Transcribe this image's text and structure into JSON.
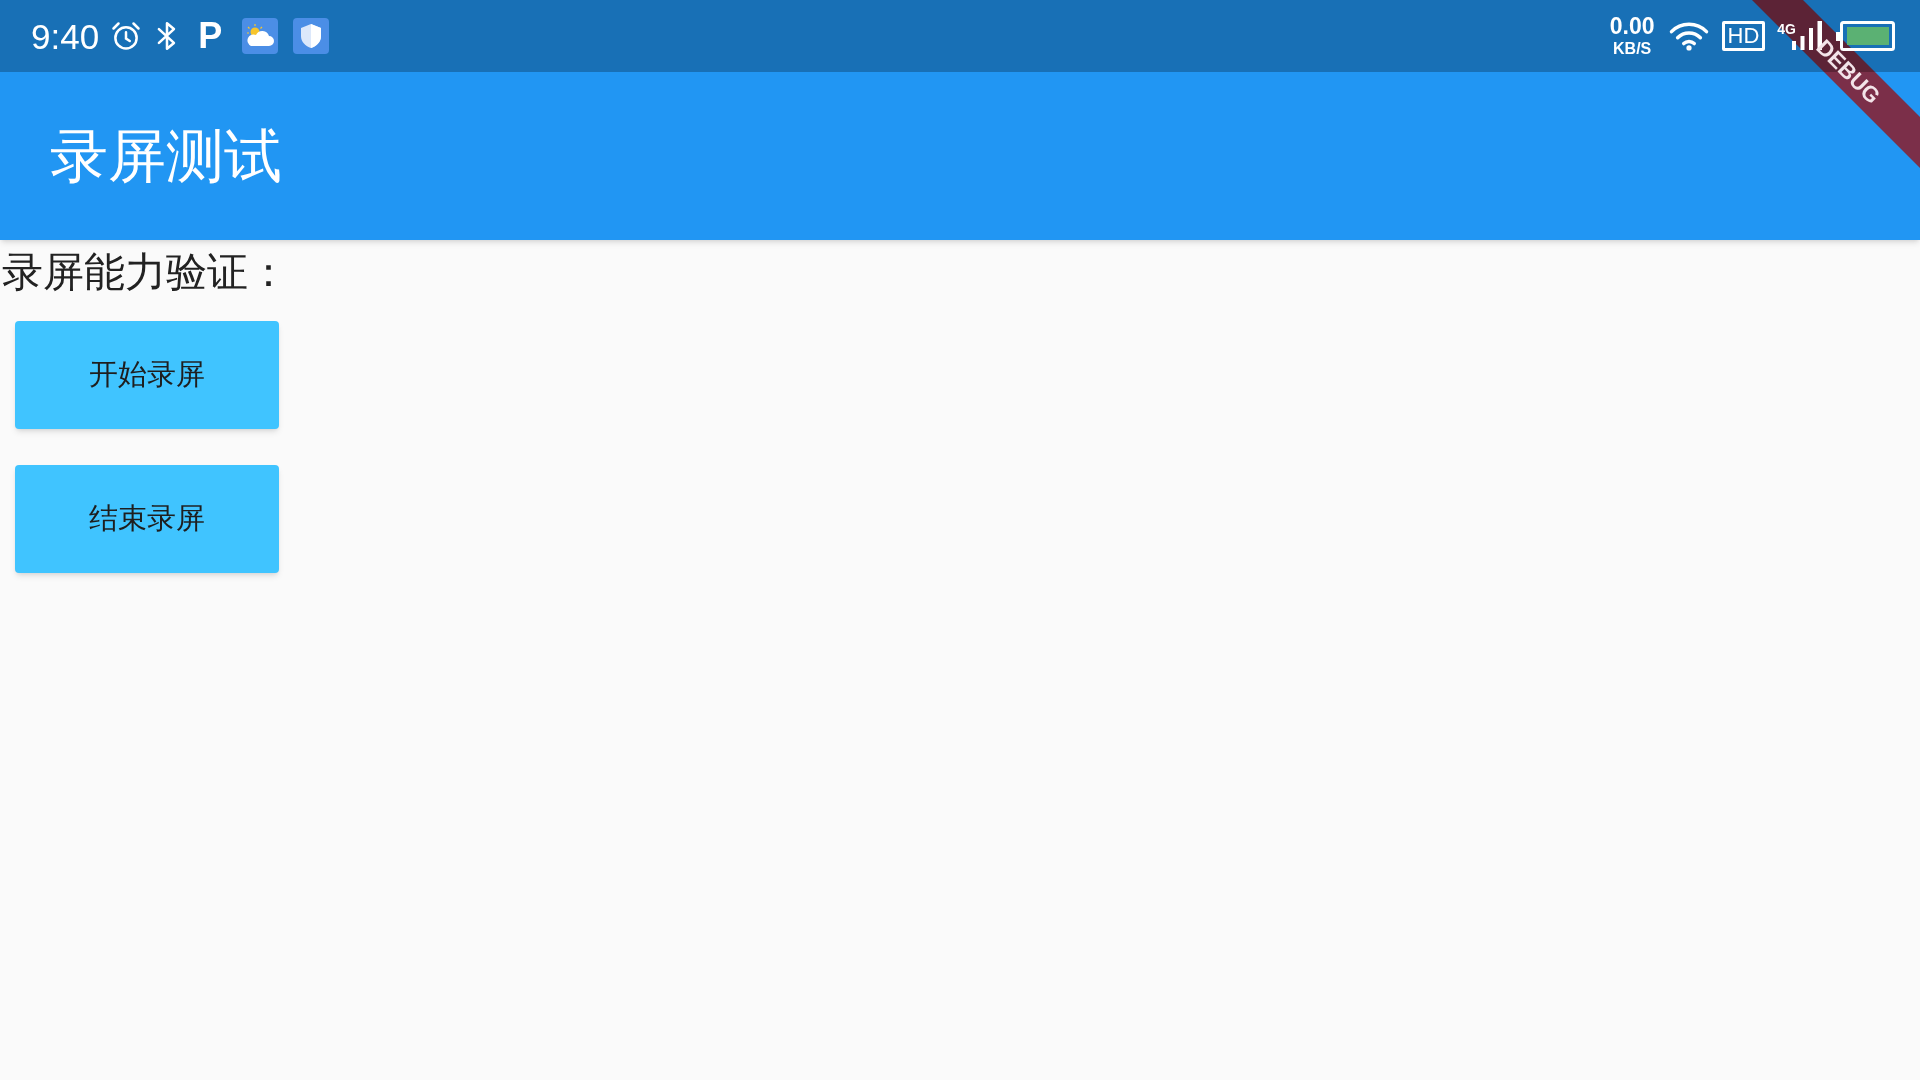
{
  "status_bar": {
    "time": "9:40",
    "notification_letter": "P",
    "net_speed": "0.00",
    "net_speed_unit": "KB/S",
    "hd_badge": "HD",
    "network_type": "4G"
  },
  "app_bar": {
    "title": "录屏测试"
  },
  "debug_banner": {
    "label": "DEBUG"
  },
  "content": {
    "heading": "录屏能力验证：",
    "buttons": [
      {
        "label": "开始录屏"
      },
      {
        "label": "结束录屏"
      }
    ]
  }
}
